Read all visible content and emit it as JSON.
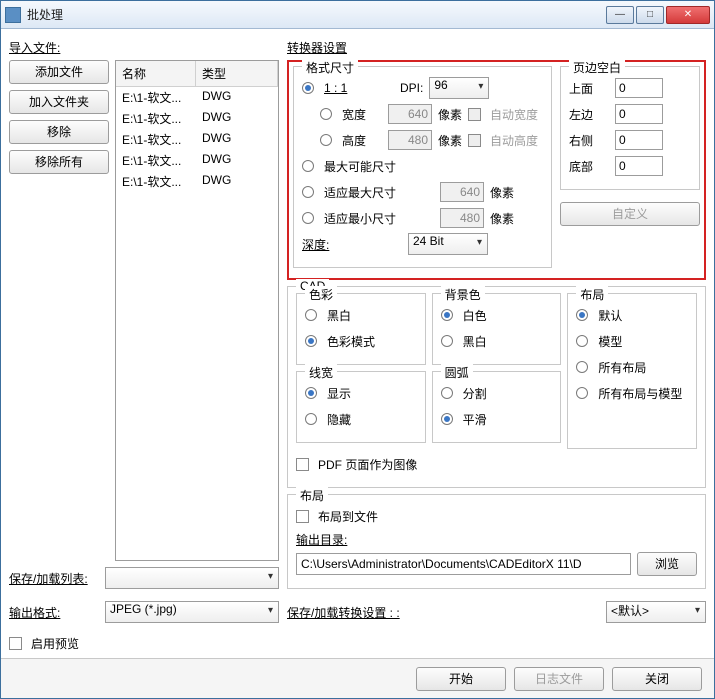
{
  "window": {
    "title": "批处理"
  },
  "winbtns": {
    "min": "—",
    "max": "□",
    "close": "✕"
  },
  "left": {
    "import_label": "导入文件:",
    "add_file": "添加文件",
    "add_folder": "加入文件夹",
    "remove": "移除",
    "remove_all": "移除所有",
    "col_name": "名称",
    "col_type": "类型",
    "files": [
      {
        "name": "E:\\1-软文...",
        "type": "DWG"
      },
      {
        "name": "E:\\1-软文...",
        "type": "DWG"
      },
      {
        "name": "E:\\1-软文...",
        "type": "DWG"
      },
      {
        "name": "E:\\1-软文...",
        "type": "DWG"
      },
      {
        "name": "E:\\1-软文...",
        "type": "DWG"
      }
    ],
    "saveload_label": "保存/加载列表:",
    "saveload_value": "",
    "outfmt_label": "输出格式:",
    "outfmt_value": "JPEG (*.jpg)",
    "preview_label": "启用预览"
  },
  "conv": {
    "title": "转换器设置",
    "fmt": {
      "title": "格式尺寸",
      "opt_11": "1 : 1",
      "dpi_label": "DPI:",
      "dpi_value": "96",
      "width_label": "宽度",
      "width_value": "640",
      "pixels": "像素",
      "auto_w": "自动宽度",
      "height_label": "高度",
      "height_value": "480",
      "auto_h": "自动高度",
      "opt_maxposs": "最大可能尺寸",
      "opt_fitmax": "适应最大尺寸",
      "fitmax_value": "640",
      "opt_fitmin": "适应最小尺寸",
      "fitmin_value": "480",
      "depth_label": "深度:",
      "depth_value": "24 Bit"
    },
    "margin": {
      "title": "页边空白",
      "top": "上面",
      "left": "左边",
      "right": "右侧",
      "bottom": "底部",
      "v_top": "0",
      "v_left": "0",
      "v_right": "0",
      "v_bottom": "0",
      "custom": "自定义"
    },
    "cad": {
      "title": "CAD",
      "palette": {
        "title": "色彩",
        "bw": "黑白",
        "color": "色彩模式"
      },
      "bg": {
        "title": "背景色",
        "white": "白色",
        "black": "黑白"
      },
      "layout": {
        "title": "布局",
        "def": "默认",
        "model": "模型",
        "all": "所有布局",
        "allm": "所有布局与模型"
      },
      "lw": {
        "title": "线宽",
        "show": "显示",
        "hide": "隐藏"
      },
      "arc": {
        "title": "圆弧",
        "split": "分割",
        "smooth": "平滑"
      }
    },
    "pdf_as_image": "PDF 页面作为图像",
    "layoutgrp": {
      "title": "布局",
      "to_files": "布局到文件",
      "outdir_label": "输出目录:",
      "outdir_value": "C:\\Users\\Administrator\\Documents\\CADEditorX 11\\D",
      "browse": "浏览"
    },
    "saveload_label": "保存/加载转换设置 : :",
    "saveload_value": "<默认>"
  },
  "footer": {
    "start": "开始",
    "log": "日志文件",
    "close": "关闭"
  }
}
